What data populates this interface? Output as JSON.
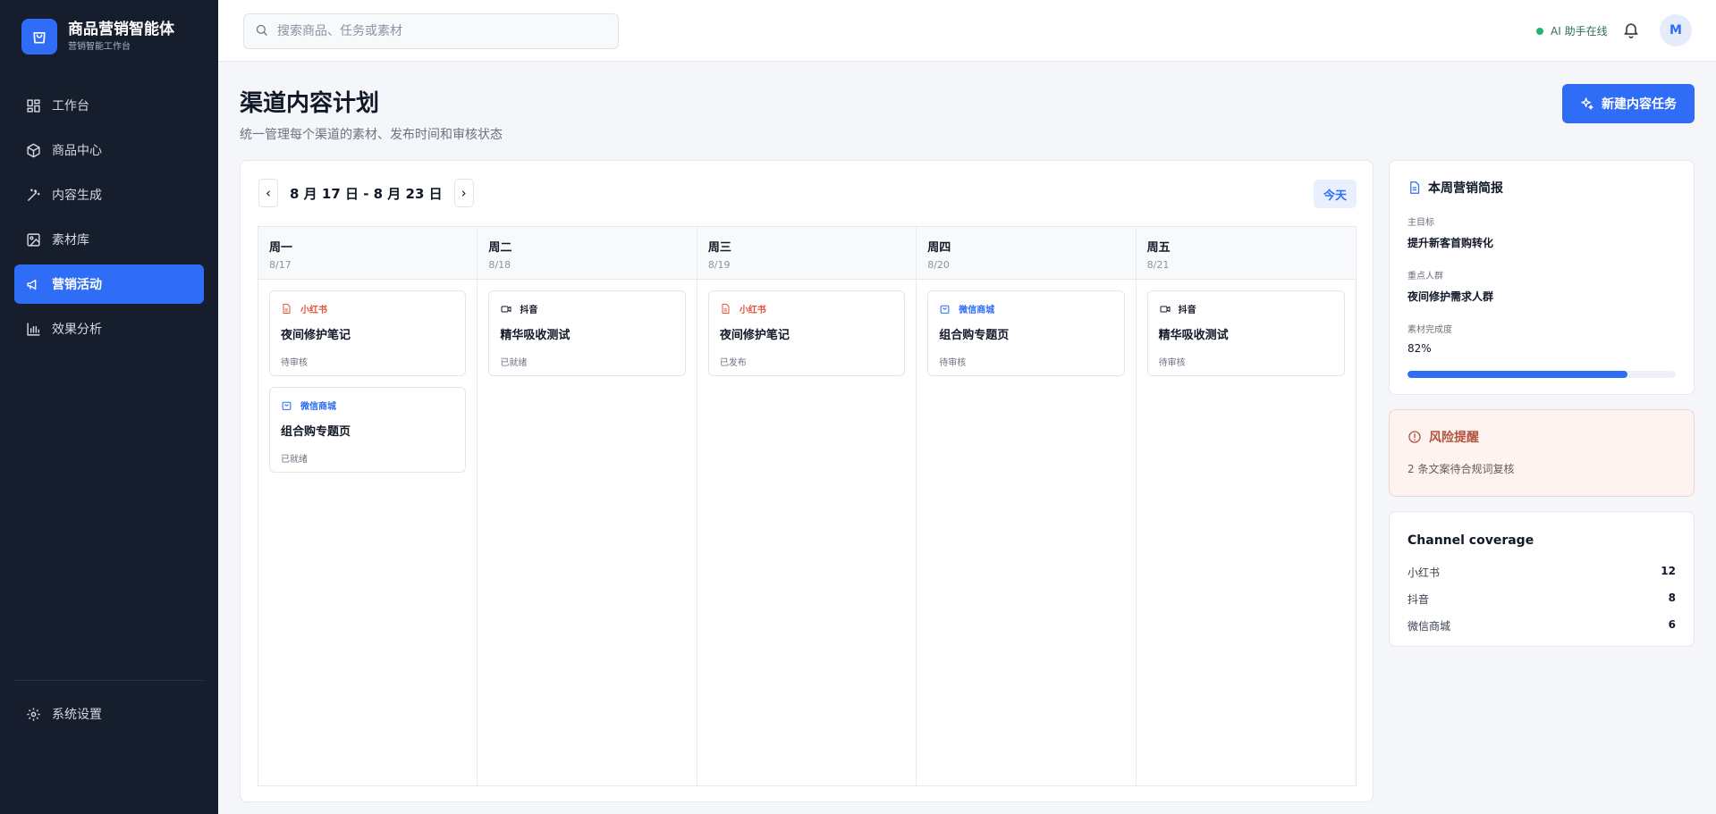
{
  "brand": {
    "title": "商品营销智能体",
    "subtitle": "营销智能工作台",
    "icon": "shopping-bag-icon"
  },
  "sidebar": {
    "items": [
      {
        "label": "工作台",
        "icon": "dashboard-icon",
        "active": false
      },
      {
        "label": "商品中心",
        "icon": "box-icon",
        "active": false
      },
      {
        "label": "内容生成",
        "icon": "magic-wand-icon",
        "active": false
      },
      {
        "label": "素材库",
        "icon": "image-icon",
        "active": false
      },
      {
        "label": "营销活动",
        "icon": "megaphone-icon",
        "active": true
      },
      {
        "label": "效果分析",
        "icon": "bar-chart-icon",
        "active": false
      }
    ],
    "settings": {
      "label": "系统设置",
      "icon": "gear-icon"
    }
  },
  "topbar": {
    "search_placeholder": "搜索商品、任务或素材",
    "ai_status": "AI 助手在线",
    "avatar": "M"
  },
  "header": {
    "title": "渠道内容计划",
    "subtitle": "统一管理每个渠道的素材、发布时间和审核状态",
    "new_button": "新建内容任务"
  },
  "calendar": {
    "range": "8 月 17 日 - 8 月 23 日",
    "prev": "‹",
    "next": "›",
    "today": "今天",
    "days": [
      {
        "name": "周一",
        "date": "8/17",
        "tasks": [
          {
            "channel": "小红书",
            "channel_icon": "document-icon",
            "color": "#e5533d",
            "title": "夜间修护笔记",
            "status": "待审核"
          },
          {
            "channel": "微信商城",
            "channel_icon": "shopping-bag-icon",
            "color": "#2f6df6",
            "title": "组合购专题页",
            "status": "已就绪"
          }
        ]
      },
      {
        "name": "周二",
        "date": "8/18",
        "tasks": [
          {
            "channel": "抖音",
            "channel_icon": "video-icon",
            "color": "#111827",
            "title": "精华吸收测试",
            "status": "已就绪"
          }
        ]
      },
      {
        "name": "周三",
        "date": "8/19",
        "tasks": [
          {
            "channel": "小红书",
            "channel_icon": "document-icon",
            "color": "#e5533d",
            "title": "夜间修护笔记",
            "status": "已发布"
          }
        ]
      },
      {
        "name": "周四",
        "date": "8/20",
        "tasks": [
          {
            "channel": "微信商城",
            "channel_icon": "shopping-bag-icon",
            "color": "#2f6df6",
            "title": "组合购专题页",
            "status": "待审核"
          }
        ]
      },
      {
        "name": "周五",
        "date": "8/21",
        "tasks": [
          {
            "channel": "抖音",
            "channel_icon": "video-icon",
            "color": "#111827",
            "title": "精华吸收测试",
            "status": "待审核"
          }
        ]
      }
    ]
  },
  "brief": {
    "title": "本周营销简报",
    "goal_label": "主目标",
    "goal": "提升新客首购转化",
    "audience_label": "重点人群",
    "audience": "夜间修护需求人群",
    "completion_label": "素材完成度",
    "completion": "82%",
    "completion_value": 0.82
  },
  "risk": {
    "title": "风险提醒",
    "text": "2 条文案待合规词复核"
  },
  "coverage": {
    "title": "Channel coverage",
    "rows": [
      {
        "name": "小红书",
        "count": "12"
      },
      {
        "name": "抖音",
        "count": "8"
      },
      {
        "name": "微信商城",
        "count": "6"
      }
    ]
  },
  "colors": {
    "accent": "#2f6df6",
    "sidebar": "#161d2d",
    "online": "#22b573",
    "risk": "#b4533c"
  }
}
